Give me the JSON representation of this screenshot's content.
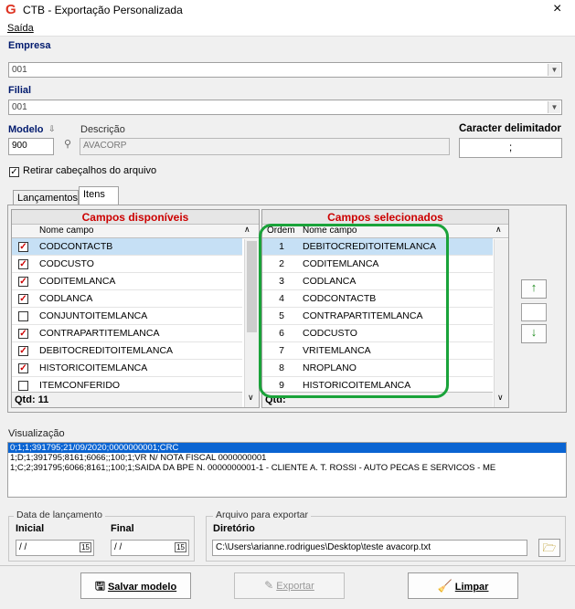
{
  "window": {
    "title": "CTB - Exportação Personalizada",
    "close": "×"
  },
  "menu": {
    "saida": "Saída"
  },
  "empresa": {
    "label": "Empresa",
    "value": "001"
  },
  "filial": {
    "label": "Filial",
    "value": "001"
  },
  "modelo": {
    "label": "Modelo",
    "value": "900"
  },
  "descricao": {
    "label": "Descrição",
    "value": "AVACORP"
  },
  "caracter": {
    "label": "Caracter delimitador",
    "value": ";"
  },
  "retirar": {
    "label": "Retirar cabeçalhos do arquivo",
    "checked": "✓"
  },
  "tabs": {
    "lancamentos": "Lançamentos",
    "itens": "Itens"
  },
  "disponiveis": {
    "title": "Campos disponíveis",
    "col": "Nome campo",
    "rows": [
      {
        "name": "CODCONTACTB",
        "checked": "✓"
      },
      {
        "name": "CODCUSTO",
        "checked": "✓"
      },
      {
        "name": "CODITEMLANCA",
        "checked": "✓"
      },
      {
        "name": "CODLANCA",
        "checked": "✓"
      },
      {
        "name": "CONJUNTOITEMLANCA",
        "checked": ""
      },
      {
        "name": "CONTRAPARTITEMLANCA",
        "checked": "✓"
      },
      {
        "name": "DEBITOCREDITOITEMLANCA",
        "checked": "✓"
      },
      {
        "name": "HISTORICOITEMLANCA",
        "checked": "✓"
      },
      {
        "name": "ITEMCONFERIDO",
        "checked": ""
      }
    ],
    "qtd": "Qtd: 11"
  },
  "selecionados": {
    "title": "Campos selecionados",
    "col_ordem": "Ordem",
    "col_nome": "Nome campo",
    "rows": [
      {
        "ordem": "1",
        "name": "DEBITOCREDITOITEMLANCA"
      },
      {
        "ordem": "2",
        "name": "CODITEMLANCA"
      },
      {
        "ordem": "3",
        "name": "CODLANCA"
      },
      {
        "ordem": "4",
        "name": "CODCONTACTB"
      },
      {
        "ordem": "5",
        "name": "CONTRAPARTITEMLANCA"
      },
      {
        "ordem": "6",
        "name": "CODCUSTO"
      },
      {
        "ordem": "7",
        "name": "VRITEMLANCA"
      },
      {
        "ordem": "8",
        "name": "NROPLANO"
      },
      {
        "ordem": "9",
        "name": "HISTORICOITEMLANCA"
      }
    ],
    "qtd": "Qtd:"
  },
  "visualizacao": {
    "label": "Visualização",
    "lines": [
      "0;1;1;391795;21/09/2020;0000000001;CRC",
      "1;D;1;391795;8161;6066;;100;1;VR N/ NOTA FISCAL 0000000001",
      "1;C;2;391795;6066;8161;;100;1;SAIDA DA BPE N. 0000000001-1 - CLIENTE A. T. ROSSI - AUTO PECAS E SERVICOS - ME"
    ]
  },
  "data_lancamento": {
    "title": "Data de lançamento",
    "inicial_label": "Inicial",
    "final_label": "Final",
    "inicial_value": "/ /",
    "final_value": "/ /",
    "cal_icon": "15"
  },
  "arquivo": {
    "title": "Arquivo para exportar",
    "diretorio_label": "Diretório",
    "path": "C:\\Users\\arianne.rodrigues\\Desktop\\teste avacorp.txt"
  },
  "buttons": {
    "salvar": "Salvar modelo",
    "exportar": "Exportar",
    "limpar": "Limpar"
  },
  "colors": {
    "header_blue": "#001a6e",
    "accent_red": "#cc0000",
    "highlight_green": "#1aa33a",
    "selection_blue": "#0a64d2"
  }
}
